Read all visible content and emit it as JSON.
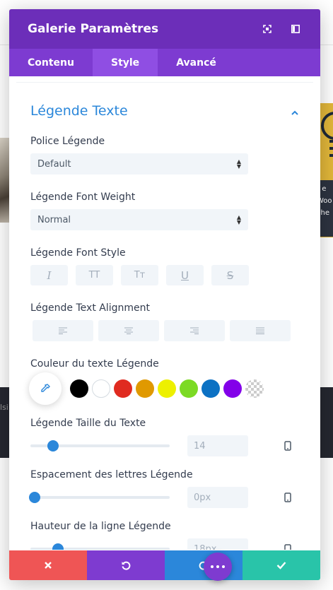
{
  "background": {
    "bottom_band_text": "lsi",
    "right_panel_lines": [
      "r e",
      "Woo",
      "che"
    ]
  },
  "modal": {
    "title": "Galerie Paramètres",
    "header_icons": [
      "fullscreen-icon",
      "sidebar-toggle-icon"
    ],
    "tabs": [
      {
        "label": "Contenu",
        "active": false
      },
      {
        "label": "Style",
        "active": true
      },
      {
        "label": "Avancé",
        "active": false
      }
    ]
  },
  "section": {
    "title": "Légende Texte",
    "expanded": true,
    "font": {
      "label": "Police Légende",
      "value": "Default"
    },
    "weight": {
      "label": "Légende Font Weight",
      "value": "Normal"
    },
    "style": {
      "label": "Légende Font Style",
      "buttons": [
        "I",
        "TT",
        "Tт",
        "U",
        "S"
      ]
    },
    "alignment": {
      "label": "Légende Text Alignment",
      "buttons": [
        "align-left",
        "align-center",
        "align-right",
        "align-justify"
      ]
    },
    "color": {
      "label": "Couleur du texte Légende",
      "swatches": [
        "#000000",
        "#ffffff",
        "#e02b20",
        "#e09900",
        "#edf000",
        "#7cda24",
        "#0c71c3",
        "#8300e9",
        "transparent"
      ]
    },
    "size": {
      "label": "Légende Taille du Texte",
      "value": "14",
      "slider_fraction": 0.16
    },
    "letter_spacing": {
      "label": "Espacement des lettres Légende",
      "value": "0px",
      "slider_fraction": 0.03
    },
    "line_height": {
      "label": "Hauteur de la ligne Légende",
      "value": "18px",
      "slider_fraction": 0.2
    }
  },
  "footer": {
    "colors": {
      "cancel": "#ef5555",
      "undo": "#7e3bd0",
      "redo": "#2b87da",
      "save": "#29c4a9"
    }
  }
}
